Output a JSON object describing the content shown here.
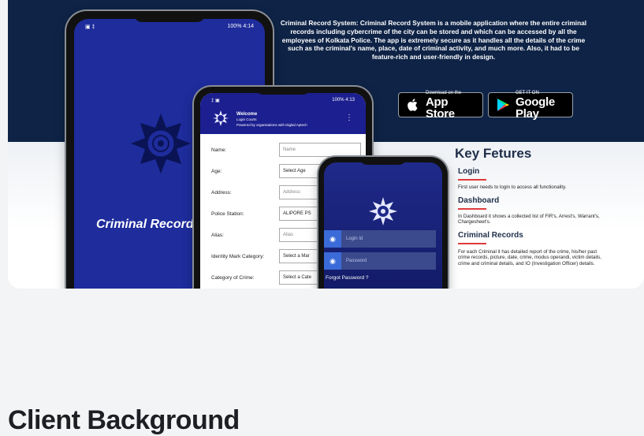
{
  "banner": {
    "description": "Criminal Record System: Criminal Record System is a mobile application where the entire criminal records including cybercrime of the city can be stored and which can be accessed by all the employees of Kolkata Police. The app is extremely secure as it handles all the details of the crime such as the criminal's name, place, date of criminal activity, and much more. Also, it had to be feature-rich and user-friendly in design.",
    "app_store_small": "Download on the",
    "app_store_big": "App Store",
    "google_play_small": "GET IT ON",
    "google_play_big": "Google Play"
  },
  "phones": {
    "phone1": {
      "status_left": "▣  ‡",
      "status_right": "100%  4:14",
      "title": "Criminal Record"
    },
    "phone2": {
      "status_left": "‡  ▣",
      "status_right": "100%  4:13",
      "welcome": "Welcome",
      "subtitle": "Login Courts",
      "powered": "Powered by organisations with Digital Aptech",
      "menu": "⋮",
      "form": [
        {
          "label": "Name:",
          "value": "Name"
        },
        {
          "label": "Age:",
          "value": "Select Age"
        },
        {
          "label": "Address:",
          "value": "Address"
        },
        {
          "label": "Police Station:",
          "value": "ALIPORE PS"
        },
        {
          "label": "Alias:",
          "value": "Alias"
        },
        {
          "label": "Identity Mark Category:",
          "value": "Select a Mar"
        },
        {
          "label": "Category of Crime:",
          "value": "Select a Cate"
        }
      ]
    },
    "phone3": {
      "login_id": "Login Id",
      "password": "Password",
      "forgot": "Forgot Password ?"
    }
  },
  "features": {
    "title": "Key Fetures",
    "items": [
      {
        "heading": "Login",
        "text": "First user needs to login to access all functionality."
      },
      {
        "heading": "Dashboard",
        "text": "In Dashboard it shows a collected list of FIR's, Arrest's, Warrant's, Chargesheet's."
      },
      {
        "heading": "Criminal Records",
        "text": "For each Criminal it has detailed report of the crime, his/her past crime records, picture, date, crime, modus operandi, victim details, crime and criminal details, and IO (Investigation Officer) details."
      }
    ]
  },
  "section_heading": "Client Background",
  "colors": {
    "navy": "#0e2346",
    "app_blue": "#1e2c9c",
    "accent_red": "#e03a3a",
    "heading_dark": "#1d1f24"
  }
}
